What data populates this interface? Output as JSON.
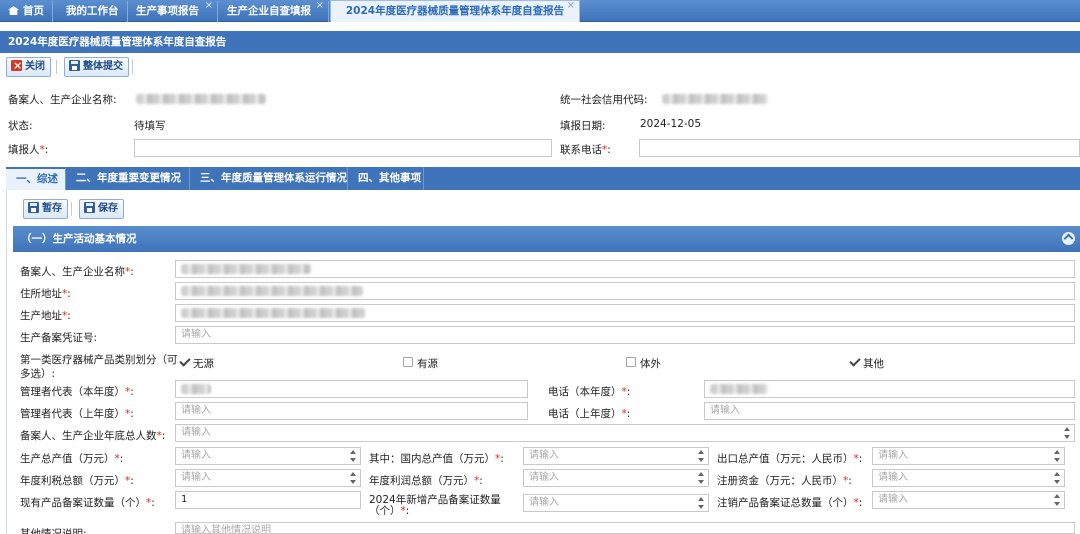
{
  "top_tabs": [
    {
      "label": "首页"
    },
    {
      "label": "我的工作台"
    },
    {
      "label": "生产事项报告"
    },
    {
      "label": "生产企业自查填报"
    },
    {
      "label": "2024年度医疗器械质量管理体系年度自查报告"
    }
  ],
  "close_glyph": "×",
  "page_title": "2024年度医疗器械质量管理体系年度自查报告",
  "toolbar": {
    "close_label": "关闭",
    "submit_label": "整体提交"
  },
  "header": {
    "company_label": "备案人、生产企业名称:",
    "credit_code_label": "统一社会信用代码:",
    "status_label": "状态:",
    "status_value": "待填写",
    "date_label": "填报日期:",
    "date_value": "2024-12-05",
    "filler_label": "填报人",
    "phone_label": "联系电话",
    "required_mark": "*",
    "colon": ":"
  },
  "section_tabs": [
    {
      "label": "一、综述"
    },
    {
      "label": "二、年度重要变更情况"
    },
    {
      "label": "三、年度质量管理体系运行情况"
    },
    {
      "label": "四、其他事项"
    }
  ],
  "panel_toolbar": {
    "draft_label": "暂存",
    "save_label": "保存"
  },
  "group_title": "（一）生产活动基本情况",
  "form": {
    "company_name_label": "备案人、生产企业名称",
    "address_label": "住所地址",
    "production_address_label": "生产地址",
    "cert_no_label": "生产备案凭证号:",
    "category_label_1": "第一类医疗器械产品类别划分（可",
    "category_label_2": "多选）:",
    "categories": [
      {
        "label": "无源",
        "checked": true
      },
      {
        "label": "有源",
        "checked": false
      },
      {
        "label": "体外",
        "checked": false
      },
      {
        "label": "其他",
        "checked": true
      }
    ],
    "manager_cur_label": "管理者代表（本年度）",
    "phone_cur_label": "电话（本年度）",
    "manager_prev_label": "管理者代表（上年度）",
    "phone_prev_label": "电话（上年度）",
    "headcount_label": "备案人、生产企业年底总人数",
    "gross_output_label": "生产总产值（万元）",
    "domestic_output_label": "其中：国内总产值（万元）",
    "export_output_label": "出口总产值（万元：人民币）",
    "tax_label": "年度利税总额（万元）",
    "profit_label": "年度利润总额（万元）",
    "capital_label": "注册资金（万元：人民币）",
    "existing_cert_label": "现有产品备案证数量（个）",
    "existing_cert_value": "1",
    "new_cert_label": "2024年新增产品备案证数量（个）",
    "cancel_cert_label": "注销产品备案证总数量（个）",
    "other_label": "其他情况说明:",
    "placeholder": "请输入",
    "other_placeholder": "请输入其他情况说明"
  }
}
